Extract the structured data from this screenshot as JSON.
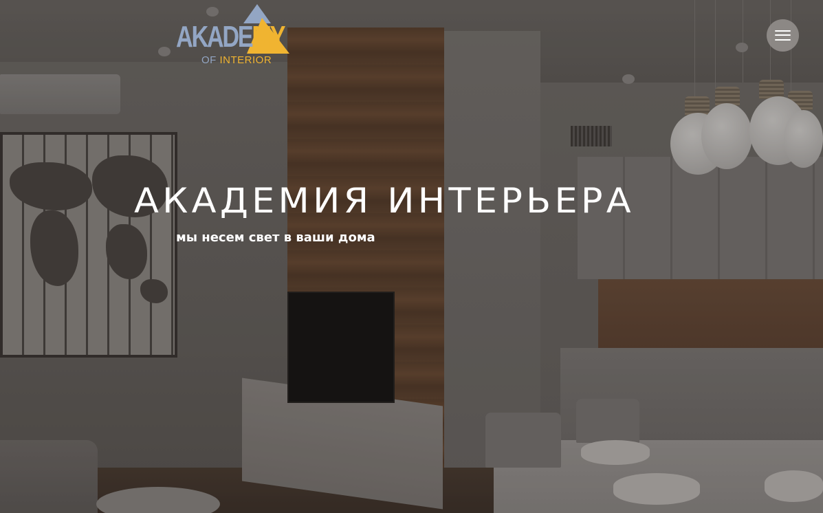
{
  "logo": {
    "word_part1": "AKADE",
    "word_part2": "MY",
    "sub_part1": "OF",
    "sub_part2": " INTERIOR",
    "colors": {
      "blue": "#93a6c4",
      "yellow": "#f0b431"
    }
  },
  "menu": {
    "icon": "hamburger-menu-icon"
  },
  "hero": {
    "title": "АКАДЕМИЯ ИНТЕРЬЕРА",
    "subtitle": "мы несем свет в ваши дома"
  }
}
